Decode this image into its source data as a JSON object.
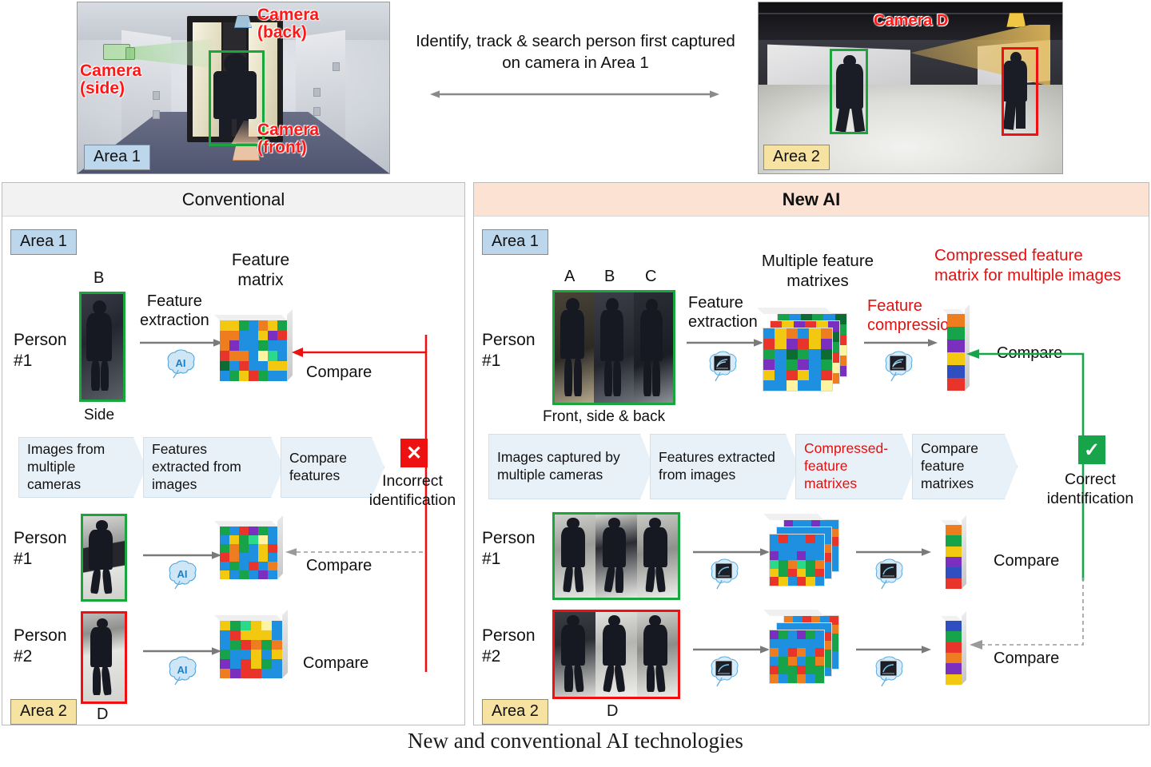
{
  "top": {
    "area1_photo": {
      "badge": "Area 1",
      "labels": {
        "side": "Camera\n(side)",
        "back": "Camera\n(back)",
        "front": "Camera\n(front)"
      }
    },
    "area2_photo": {
      "badge": "Area 2",
      "label_d": "Camera D"
    },
    "center_text": "Identify, track & search person first captured on camera in Area 1"
  },
  "conventional": {
    "header": "Conventional",
    "area1_badge": "Area 1",
    "area2_badge": "Area 2",
    "person1_label": "Person\n#1",
    "person2_label": "Person\n#2",
    "image_b": "B",
    "image_b_caption": "Side",
    "image_d": "D",
    "feature_matrix_label": "Feature\nmatrix",
    "feature_extraction_label": "Feature\nextraction",
    "ai_icon_label": "AI",
    "compare_top": "Compare",
    "compare_mid": "Compare",
    "compare_bottom": "Compare",
    "flow": [
      "Images from multiple cameras",
      "Features extracted from images",
      "Compare features"
    ],
    "result_icon": "✕",
    "result_label": "Incorrect\nidentification"
  },
  "newai": {
    "header": "New AI",
    "area1_badge": "Area 1",
    "area2_badge": "Area 2",
    "person1_label": "Person\n#1",
    "person2_label": "Person\n#2",
    "image_a": "A",
    "image_b": "B",
    "image_c": "C",
    "images_caption": "Front, side & back",
    "image_d": "D",
    "feature_extraction_label": "Feature\nextraction",
    "multiple_matrices_label": "Multiple feature\nmatrixes",
    "feature_compression_label": "Feature\ncompression",
    "compressed_matrix_label": "Compressed feature\nmatrix for multiple images",
    "compare_top": "Compare",
    "compare_mid": "Compare",
    "compare_bottom": "Compare",
    "flow": [
      "Images captured by multiple cameras",
      "Features extracted from images",
      "Compressed-feature matrixes",
      "Compare feature matrixes"
    ],
    "result_icon": "✓",
    "result_label": "Correct\nidentification"
  },
  "caption": "New and conventional AI technologies",
  "colors": {
    "red": "#ee1111",
    "green": "#17a44a",
    "area1_badge_bg": "#bcd6ec",
    "area2_badge_bg": "#f7e3a1",
    "newai_header_bg": "#fbe2d3",
    "conventional_header_bg": "#f2f2f2",
    "chevron_bg": "#e9f1f8"
  },
  "matrices": {
    "palette": [
      "#e8342a",
      "#1f8fe0",
      "#16a34a",
      "#f2c811",
      "#ee7d1f",
      "#7a2fbf",
      "#2bd98a",
      "#fdf3a0",
      "#0e6b34",
      "#3cb1f2"
    ],
    "conv_top": [
      [
        "#f2c811",
        "#f2c811",
        "#16a34a",
        "#1f8fe0",
        "#ee7d1f",
        "#f2c811",
        "#16a34a"
      ],
      [
        "#ee7d1f",
        "#ee7d1f",
        "#1f8fe0",
        "#1f8fe0",
        "#f2c811",
        "#7a2fbf",
        "#e8342a"
      ],
      [
        "#ee7d1f",
        "#7a2fbf",
        "#1f8fe0",
        "#1f8fe0",
        "#16a34a",
        "#1f8fe0",
        "#1f8fe0"
      ],
      [
        "#e8342a",
        "#ee7d1f",
        "#ee7d1f",
        "#1f8fe0",
        "#fdf3a0",
        "#2bd98a",
        "#1f8fe0"
      ],
      [
        "#0e6b34",
        "#1f8fe0",
        "#e8342a",
        "#1f8fe0",
        "#1f8fe0",
        "#f2c811",
        "#f2c811"
      ],
      [
        "#1f8fe0",
        "#16a34a",
        "#f2c811",
        "#e8342a",
        "#16a34a",
        "#1f8fe0",
        "#1f8fe0"
      ]
    ],
    "conv_p1": [
      [
        "#16a34a",
        "#1f8fe0",
        "#e8342a",
        "#7a2fbf",
        "#16a34a",
        "#1f8fe0"
      ],
      [
        "#1f8fe0",
        "#f2c811",
        "#16a34a",
        "#2bd98a",
        "#fdf3a0",
        "#1f8fe0"
      ],
      [
        "#16a34a",
        "#ee7d1f",
        "#16a34a",
        "#1f8fe0",
        "#f2c811",
        "#e8342a"
      ],
      [
        "#e8342a",
        "#ee7d1f",
        "#1f8fe0",
        "#1f8fe0",
        "#f2c811",
        "#1f8fe0"
      ],
      [
        "#1f8fe0",
        "#16a34a",
        "#1f8fe0",
        "#e8342a",
        "#1f8fe0",
        "#ee7d1f"
      ],
      [
        "#f2c811",
        "#1f8fe0",
        "#16a34a",
        "#1f8fe0",
        "#7a2fbf",
        "#1f8fe0"
      ]
    ],
    "conv_p2": [
      [
        "#f2c811",
        "#16a34a",
        "#2bd98a",
        "#f2c811",
        "#fdf3a0",
        "#1f8fe0"
      ],
      [
        "#1f8fe0",
        "#e8342a",
        "#f2c811",
        "#f2c811",
        "#f2c811",
        "#1f8fe0"
      ],
      [
        "#1f8fe0",
        "#16a34a",
        "#e8342a",
        "#ee7d1f",
        "#16a34a",
        "#ee7d1f"
      ],
      [
        "#16a34a",
        "#1f8fe0",
        "#1f8fe0",
        "#f2c811",
        "#1f8fe0",
        "#f2c811"
      ],
      [
        "#7a2fbf",
        "#1f8fe0",
        "#e8342a",
        "#f2c811",
        "#16a34a",
        "#1f8fe0"
      ],
      [
        "#ee7d1f",
        "#7a2fbf",
        "#e8342a",
        "#e8342a",
        "#1f8fe0",
        "#1f8fe0"
      ]
    ],
    "newai_top": [
      [
        "#1f8fe0",
        "#e8342a",
        "#f2c811",
        "#f2c811",
        "#ee7d1f",
        "#16a34a"
      ],
      [
        "#ee7d1f",
        "#e8342a",
        "#1f8fe0",
        "#f2c811",
        "#1f8fe0",
        "#7a2fbf"
      ],
      [
        "#0e6b34",
        "#1f8fe0",
        "#16a34a",
        "#1f8fe0",
        "#1f8fe0",
        "#1f8fe0"
      ],
      [
        "#f2c811",
        "#16a34a",
        "#ee7d1f",
        "#7a2fbf",
        "#e8342a",
        "#1f8fe0"
      ],
      [
        "#1f8fe0",
        "#1f8fe0",
        "#e8342a",
        "#16a34a",
        "#f2c811",
        "#16a34a"
      ],
      [
        "#1f8fe0",
        "#1f8fe0",
        "#1f8fe0",
        "#fdf3a0",
        "#2bd98a",
        "#1f8fe0"
      ]
    ],
    "newai_p1": [
      [
        "#1f8fe0",
        "#16a34a",
        "#e8342a",
        "#1f8fe0",
        "#1f8fe0",
        "#16a34a"
      ],
      [
        "#ee7d1f",
        "#1f8fe0",
        "#f2c811",
        "#1f8fe0",
        "#e8342a",
        "#1f8fe0"
      ],
      [
        "#1f8fe0",
        "#e8342a",
        "#7a2fbf",
        "#16a34a",
        "#1f8fe0",
        "#f2c811"
      ],
      [
        "#ee7d1f",
        "#ee7d1f",
        "#16a34a",
        "#2bd98a",
        "#1f8fe0",
        "#16a34a"
      ],
      [
        "#16a34a",
        "#1f8fe0",
        "#e8342a",
        "#1f8fe0",
        "#f2c811",
        "#1f8fe0"
      ],
      [
        "#f2c811",
        "#f2c811",
        "#f2c811",
        "#1f8fe0",
        "#1f8fe0",
        "#e8342a"
      ]
    ],
    "newai_p2": [
      [
        "#7a2fbf",
        "#1f8fe0",
        "#16a34a",
        "#e8342a",
        "#1f8fe0",
        "#16a34a"
      ],
      [
        "#f2c811",
        "#1f8fe0",
        "#2bd98a",
        "#1f8fe0",
        "#16a34a",
        "#1f8fe0"
      ],
      [
        "#e8342a",
        "#e8342a",
        "#ee7d1f",
        "#16a34a",
        "#1f8fe0",
        "#f2c811"
      ],
      [
        "#16a34a",
        "#ee7d1f",
        "#e8342a",
        "#1f8fe0",
        "#1f8fe0",
        "#16a34a"
      ],
      [
        "#16a34a",
        "#1f8fe0",
        "#16a34a",
        "#f2c811",
        "#e8342a",
        "#1f8fe0"
      ],
      [
        "#1f8fe0",
        "#1f8fe0",
        "#f2c811",
        "#16a34a",
        "#1f8fe0",
        "#ee7d1f"
      ]
    ],
    "compressed_top": [
      "#ee7d1f",
      "#16a34a",
      "#7a2fbf",
      "#f2c811",
      "#2f4fc0",
      "#e8342a"
    ],
    "compressed_p1": [
      "#ee7d1f",
      "#16a34a",
      "#f2c811",
      "#7a2fbf",
      "#2f4fc0",
      "#e8342a"
    ],
    "compressed_p2": [
      "#2f4fc0",
      "#16a34a",
      "#e8342a",
      "#ee7d1f",
      "#7a2fbf",
      "#f2c811"
    ]
  }
}
